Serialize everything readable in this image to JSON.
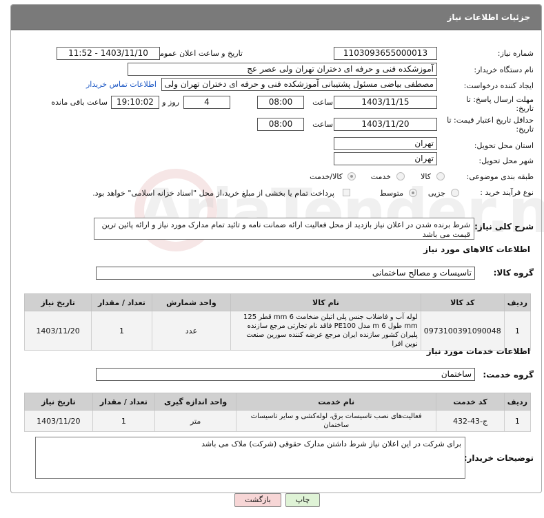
{
  "header": {
    "title": "جزئیات اطلاعات نیاز"
  },
  "fields": {
    "need_number_label": "شماره نیاز:",
    "need_number": "1103093655000013",
    "announce_label": "تاریخ و ساعت اعلان عمومی:",
    "announce_value": "1403/11/10 - 11:52",
    "buyer_org_label": "نام دستگاه خریدار:",
    "buyer_org": "آموزشکده فنی و حرفه ای دختران تهران ولی عصر عج",
    "requester_label": "ایجاد کننده درخواست:",
    "requester": "مصطفی بیاضی مسئول پشتیبانی آموزشکده فنی و حرفه ای دختران تهران ولی",
    "contact_link": "اطلاعات تماس خریدار",
    "reply_deadline_label": "مهلت ارسال پاسخ: تا تاریخ:",
    "reply_date": "1403/11/15",
    "time_label": "ساعت",
    "reply_time": "08:00",
    "days_count": "4",
    "days_label": "روز و",
    "remaining_time": "19:10:02",
    "remaining_label": "ساعت باقی مانده",
    "price_validity_label": "حداقل تاریخ اعتبار قیمت: تا تاریخ:",
    "price_date": "1403/11/20",
    "price_time": "08:00",
    "province_label": "استان محل تحویل:",
    "province": "تهران",
    "city_label": "شهر محل تحویل:",
    "city": "تهران",
    "category_label": "طبقه بندی موضوعی:",
    "category_options": [
      "کالا",
      "خدمت",
      "کالا/خدمت"
    ],
    "process_label": "نوع فرآیند خرید :",
    "process_options": [
      "جزیی",
      "متوسط"
    ],
    "payment_note": "پرداخت تمام یا بخشی از مبلغ خرید،از محل \"اسناد خزانه اسلامی\" خواهد بود."
  },
  "description": {
    "label": "شرح کلی نیاز:",
    "text": "شرط برنده شدن در اعلان نیاز بازدید از محل فعالیت ارائه ضمانت نامه و تائید تمام مدارک مورد نیاز و ارائه پائین ترین قیمت می باشد"
  },
  "goods": {
    "section_title": "اطلاعات کالاهای مورد نیاز",
    "group_label": "گروه کالا:",
    "group_value": "تاسیسات و مصالح ساختمانی",
    "columns": [
      "ردیف",
      "کد کالا",
      "نام کالا",
      "واحد شمارش",
      "تعداد / مقدار",
      "تاریخ نیاز"
    ],
    "rows": [
      {
        "row": "1",
        "code": "0973100391090048",
        "name": "لوله آب و فاضلاب جنس پلی اتیلن ضخامت 6 mm قطر 125 mm طول 6 m مدل PE100 فاقد نام تجارتی مرجع سازنده پلیران کشور سازنده ایران مرجع عرضه کننده سورین صنعت نوین افرا",
        "unit": "عدد",
        "qty": "1",
        "date": "1403/11/20"
      }
    ]
  },
  "services": {
    "section_title": "اطلاعات خدمات مورد نیاز",
    "group_label": "گروه خدمت:",
    "group_value": "ساختمان",
    "columns": [
      "ردیف",
      "کد خدمت",
      "نام خدمت",
      "واحد اندازه گیری",
      "تعداد / مقدار",
      "تاریخ نیاز"
    ],
    "rows": [
      {
        "row": "1",
        "code": "ج-43-432",
        "name": "فعالیت‌های نصب تاسیسات برق، لوله‌کشی و سایر تاسیسات ساختمان",
        "unit": "متر",
        "qty": "1",
        "date": "1403/11/20"
      }
    ]
  },
  "buyer_notes": {
    "label": "توضیحات خریدار:",
    "text": "برای شرکت در این اعلان نیاز شرط داشتن مدارک حقوقی (شرکت) ملاک می باشد"
  },
  "buttons": {
    "print": "چاپ",
    "back": "بازگشت"
  },
  "colors": {
    "header_bg": "#7a7a7a",
    "link": "#1a56c4",
    "back_btn": "#f7d6d6",
    "print_btn": "#dff3d6"
  }
}
